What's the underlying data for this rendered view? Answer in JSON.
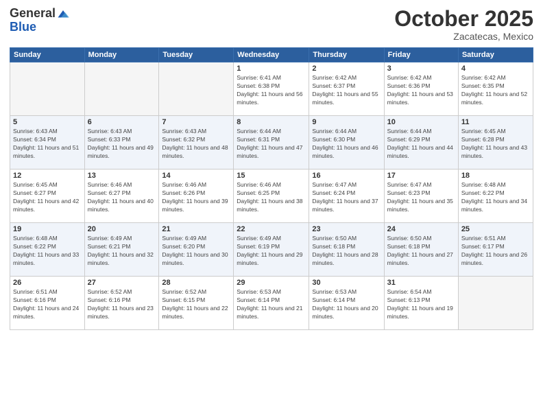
{
  "logo": {
    "general": "General",
    "blue": "Blue"
  },
  "title": "October 2025",
  "subtitle": "Zacatecas, Mexico",
  "days_of_week": [
    "Sunday",
    "Monday",
    "Tuesday",
    "Wednesday",
    "Thursday",
    "Friday",
    "Saturday"
  ],
  "weeks": [
    [
      {
        "day": "",
        "sunrise": "",
        "sunset": "",
        "daylight": ""
      },
      {
        "day": "",
        "sunrise": "",
        "sunset": "",
        "daylight": ""
      },
      {
        "day": "",
        "sunrise": "",
        "sunset": "",
        "daylight": ""
      },
      {
        "day": "1",
        "sunrise": "Sunrise: 6:41 AM",
        "sunset": "Sunset: 6:38 PM",
        "daylight": "Daylight: 11 hours and 56 minutes."
      },
      {
        "day": "2",
        "sunrise": "Sunrise: 6:42 AM",
        "sunset": "Sunset: 6:37 PM",
        "daylight": "Daylight: 11 hours and 55 minutes."
      },
      {
        "day": "3",
        "sunrise": "Sunrise: 6:42 AM",
        "sunset": "Sunset: 6:36 PM",
        "daylight": "Daylight: 11 hours and 53 minutes."
      },
      {
        "day": "4",
        "sunrise": "Sunrise: 6:42 AM",
        "sunset": "Sunset: 6:35 PM",
        "daylight": "Daylight: 11 hours and 52 minutes."
      }
    ],
    [
      {
        "day": "5",
        "sunrise": "Sunrise: 6:43 AM",
        "sunset": "Sunset: 6:34 PM",
        "daylight": "Daylight: 11 hours and 51 minutes."
      },
      {
        "day": "6",
        "sunrise": "Sunrise: 6:43 AM",
        "sunset": "Sunset: 6:33 PM",
        "daylight": "Daylight: 11 hours and 49 minutes."
      },
      {
        "day": "7",
        "sunrise": "Sunrise: 6:43 AM",
        "sunset": "Sunset: 6:32 PM",
        "daylight": "Daylight: 11 hours and 48 minutes."
      },
      {
        "day": "8",
        "sunrise": "Sunrise: 6:44 AM",
        "sunset": "Sunset: 6:31 PM",
        "daylight": "Daylight: 11 hours and 47 minutes."
      },
      {
        "day": "9",
        "sunrise": "Sunrise: 6:44 AM",
        "sunset": "Sunset: 6:30 PM",
        "daylight": "Daylight: 11 hours and 46 minutes."
      },
      {
        "day": "10",
        "sunrise": "Sunrise: 6:44 AM",
        "sunset": "Sunset: 6:29 PM",
        "daylight": "Daylight: 11 hours and 44 minutes."
      },
      {
        "day": "11",
        "sunrise": "Sunrise: 6:45 AM",
        "sunset": "Sunset: 6:28 PM",
        "daylight": "Daylight: 11 hours and 43 minutes."
      }
    ],
    [
      {
        "day": "12",
        "sunrise": "Sunrise: 6:45 AM",
        "sunset": "Sunset: 6:27 PM",
        "daylight": "Daylight: 11 hours and 42 minutes."
      },
      {
        "day": "13",
        "sunrise": "Sunrise: 6:46 AM",
        "sunset": "Sunset: 6:27 PM",
        "daylight": "Daylight: 11 hours and 40 minutes."
      },
      {
        "day": "14",
        "sunrise": "Sunrise: 6:46 AM",
        "sunset": "Sunset: 6:26 PM",
        "daylight": "Daylight: 11 hours and 39 minutes."
      },
      {
        "day": "15",
        "sunrise": "Sunrise: 6:46 AM",
        "sunset": "Sunset: 6:25 PM",
        "daylight": "Daylight: 11 hours and 38 minutes."
      },
      {
        "day": "16",
        "sunrise": "Sunrise: 6:47 AM",
        "sunset": "Sunset: 6:24 PM",
        "daylight": "Daylight: 11 hours and 37 minutes."
      },
      {
        "day": "17",
        "sunrise": "Sunrise: 6:47 AM",
        "sunset": "Sunset: 6:23 PM",
        "daylight": "Daylight: 11 hours and 35 minutes."
      },
      {
        "day": "18",
        "sunrise": "Sunrise: 6:48 AM",
        "sunset": "Sunset: 6:22 PM",
        "daylight": "Daylight: 11 hours and 34 minutes."
      }
    ],
    [
      {
        "day": "19",
        "sunrise": "Sunrise: 6:48 AM",
        "sunset": "Sunset: 6:22 PM",
        "daylight": "Daylight: 11 hours and 33 minutes."
      },
      {
        "day": "20",
        "sunrise": "Sunrise: 6:49 AM",
        "sunset": "Sunset: 6:21 PM",
        "daylight": "Daylight: 11 hours and 32 minutes."
      },
      {
        "day": "21",
        "sunrise": "Sunrise: 6:49 AM",
        "sunset": "Sunset: 6:20 PM",
        "daylight": "Daylight: 11 hours and 30 minutes."
      },
      {
        "day": "22",
        "sunrise": "Sunrise: 6:49 AM",
        "sunset": "Sunset: 6:19 PM",
        "daylight": "Daylight: 11 hours and 29 minutes."
      },
      {
        "day": "23",
        "sunrise": "Sunrise: 6:50 AM",
        "sunset": "Sunset: 6:18 PM",
        "daylight": "Daylight: 11 hours and 28 minutes."
      },
      {
        "day": "24",
        "sunrise": "Sunrise: 6:50 AM",
        "sunset": "Sunset: 6:18 PM",
        "daylight": "Daylight: 11 hours and 27 minutes."
      },
      {
        "day": "25",
        "sunrise": "Sunrise: 6:51 AM",
        "sunset": "Sunset: 6:17 PM",
        "daylight": "Daylight: 11 hours and 26 minutes."
      }
    ],
    [
      {
        "day": "26",
        "sunrise": "Sunrise: 6:51 AM",
        "sunset": "Sunset: 6:16 PM",
        "daylight": "Daylight: 11 hours and 24 minutes."
      },
      {
        "day": "27",
        "sunrise": "Sunrise: 6:52 AM",
        "sunset": "Sunset: 6:16 PM",
        "daylight": "Daylight: 11 hours and 23 minutes."
      },
      {
        "day": "28",
        "sunrise": "Sunrise: 6:52 AM",
        "sunset": "Sunset: 6:15 PM",
        "daylight": "Daylight: 11 hours and 22 minutes."
      },
      {
        "day": "29",
        "sunrise": "Sunrise: 6:53 AM",
        "sunset": "Sunset: 6:14 PM",
        "daylight": "Daylight: 11 hours and 21 minutes."
      },
      {
        "day": "30",
        "sunrise": "Sunrise: 6:53 AM",
        "sunset": "Sunset: 6:14 PM",
        "daylight": "Daylight: 11 hours and 20 minutes."
      },
      {
        "day": "31",
        "sunrise": "Sunrise: 6:54 AM",
        "sunset": "Sunset: 6:13 PM",
        "daylight": "Daylight: 11 hours and 19 minutes."
      },
      {
        "day": "",
        "sunrise": "",
        "sunset": "",
        "daylight": ""
      }
    ]
  ]
}
